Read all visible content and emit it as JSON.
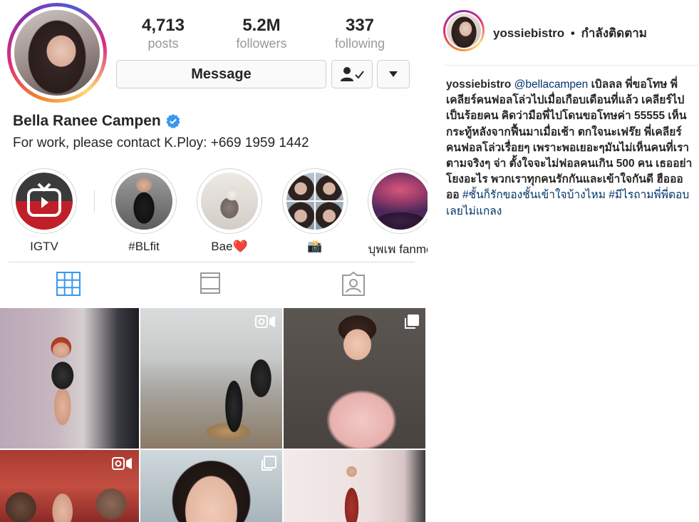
{
  "profile": {
    "stats": [
      {
        "value": "4,713",
        "label": "posts"
      },
      {
        "value": "5.2M",
        "label": "followers"
      },
      {
        "value": "337",
        "label": "following"
      }
    ],
    "message_label": "Message",
    "name": "Bella Ranee Campen",
    "bio": "For work, please contact K.Ploy: +669 1959 1442",
    "highlights": [
      {
        "label": "IGTV",
        "icon": "igtv-icon"
      },
      {
        "label": "#BLfit",
        "icon": "photo"
      },
      {
        "label": "Bae❤️",
        "icon": "photo"
      },
      {
        "label": "📸",
        "icon": "photo"
      },
      {
        "label": "บุพเพ fanme",
        "icon": "photo"
      }
    ],
    "tabs": [
      "grid-tab",
      "igtv-tab",
      "tagged-tab"
    ],
    "colors": {
      "accent": "#3897f0",
      "verified": "#3897f0",
      "link": "#003569"
    }
  },
  "comment": {
    "username": "yossiebistro",
    "separator": "•",
    "status": "กำลังติดตาม",
    "mention": "@bellacampen",
    "text": "เบิลลล พี่ขอโทษ พี่เคลียร์คนฟอลโล่วไปเมื่อเกือบเดือนที่แล้ว เคลียร์ไปเป็นร้อยคน คิดว่ามือพี่ไปโดนขอโทษค่า 55555 เห็นกระทู้หลังจากฟื้นมาเมื่อเช้า ตกใจนะเฟร๊ย พี่เคลียร์คนฟอลโล่วเรื่อยๆ เพราะพอเยอะๆมันไม่เห็นคนที่เราตามจริงๆ จ่า ตั้งใจจะไม่ฟอลคนเกิน 500 คน เธออย่าโยงอะไร พวกเราทุกคนรักกันและเข้าใจกันดี ฮือออออ",
    "hashtags": "#ชั้นก็รักของชั้นเข้าใจบ้างไหม #มีไรถามพี่พี่ตอบเลยไม่แกลง"
  }
}
